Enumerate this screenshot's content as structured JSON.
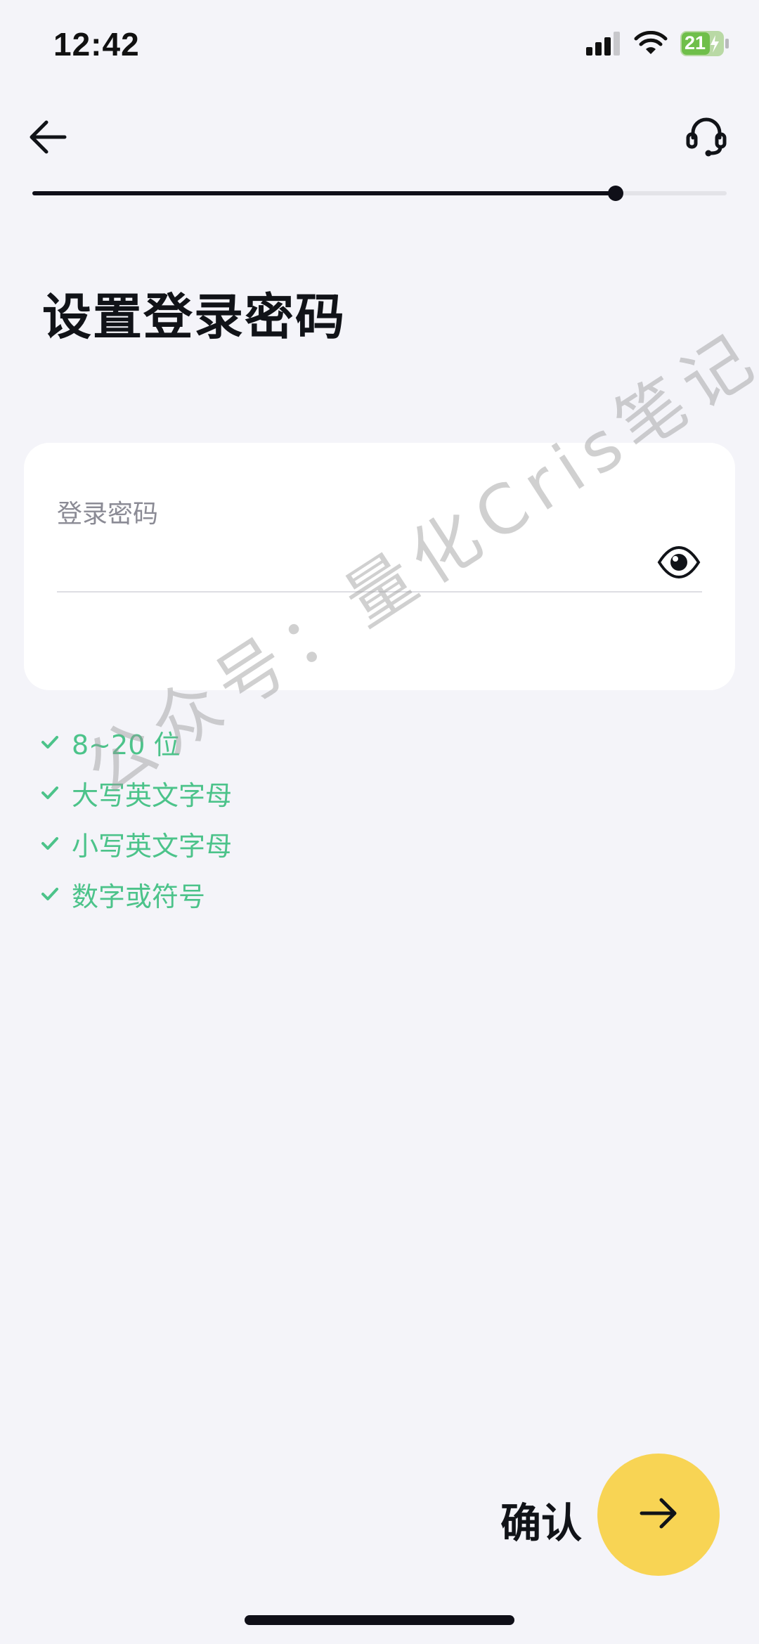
{
  "status_bar": {
    "time": "12:42",
    "battery_level": "21",
    "icons": [
      "signal-icon",
      "wifi-icon",
      "battery-charging-icon"
    ]
  },
  "nav": {
    "back_icon": "arrow-left-icon",
    "support_icon": "headset-icon"
  },
  "progress": {
    "fraction": 0.84
  },
  "page": {
    "title": "设置登录密码"
  },
  "form": {
    "password_label": "登录密码",
    "password_value": "",
    "password_placeholder": "",
    "visibility_icon": "eye-icon"
  },
  "rules": [
    {
      "label": "8~20 位",
      "satisfied": true
    },
    {
      "label": "大写英文字母",
      "satisfied": true
    },
    {
      "label": "小写英文字母",
      "satisfied": true
    },
    {
      "label": "数字或符号",
      "satisfied": true
    }
  ],
  "watermark": "公众号：量化Cris笔记",
  "footer": {
    "confirm_label": "确认",
    "confirm_icon": "arrow-right-icon"
  },
  "colors": {
    "accent": "#f8d454",
    "rule_ok": "#4cc38a",
    "progress": "#0f0f18",
    "background": "#f4f4f9"
  }
}
